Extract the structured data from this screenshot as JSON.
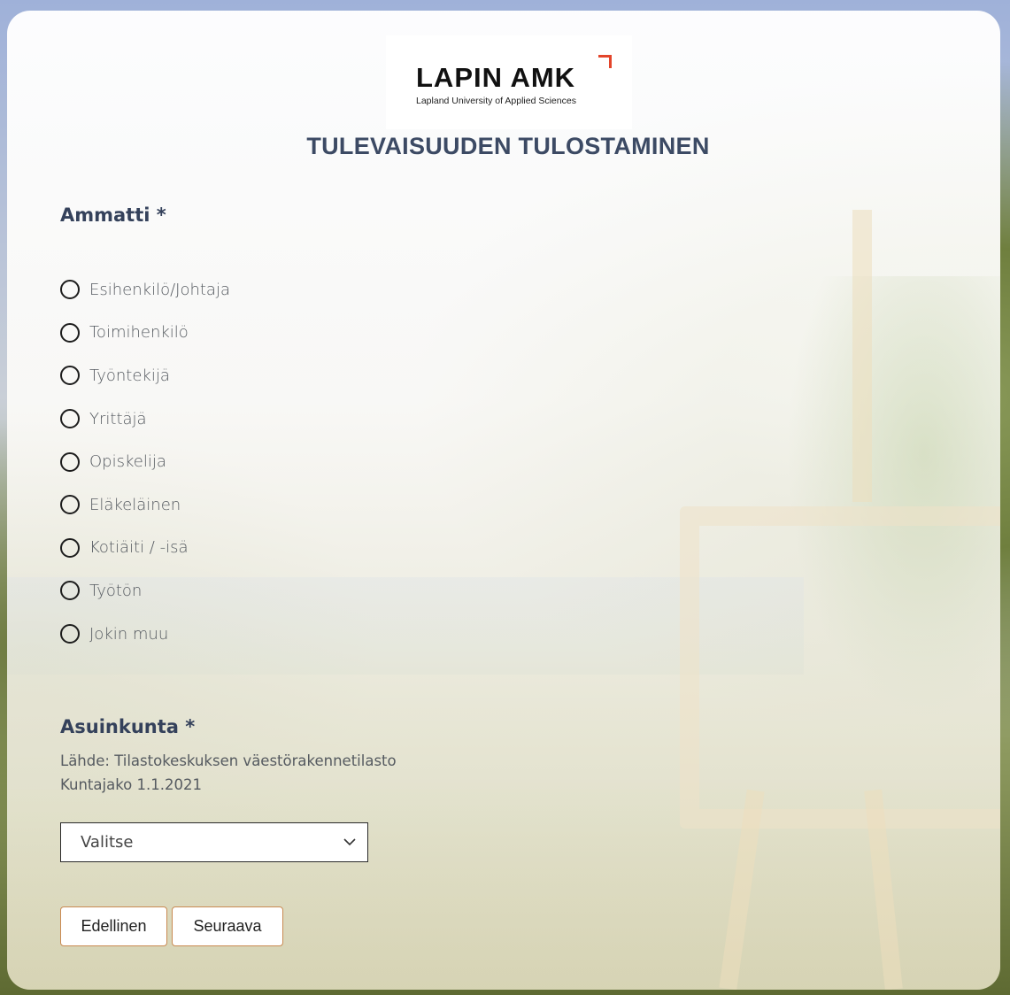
{
  "logo": {
    "name": "LAPIN AMK",
    "subtitle": "Lapland University of Applied Sciences"
  },
  "page_title": "TULEVAISUUDEN TULOSTAMINEN",
  "questions": {
    "occupation": {
      "label": "Ammatti",
      "required_mark": "*",
      "options": [
        "Esihenkilö/Johtaja",
        "Toimihenkilö",
        "Työntekijä",
        "Yrittäjä",
        "Opiskelija",
        "Eläkeläinen",
        "Kotiäiti / -isä",
        "Työtön",
        "Jokin muu"
      ]
    },
    "municipality": {
      "label": "Asuinkunta",
      "required_mark": "*",
      "source_line": "Lähde: Tilastokeskuksen väestörakennetilasto",
      "division_line": "Kuntajako 1.1.2021",
      "select_value": "Valitse"
    }
  },
  "navigation": {
    "previous_label": "Edellinen",
    "next_label": "Seuraava"
  },
  "colors": {
    "title": "#3c4a64",
    "accent_border": "#c98a52",
    "logo_mark": "#e3452b"
  }
}
